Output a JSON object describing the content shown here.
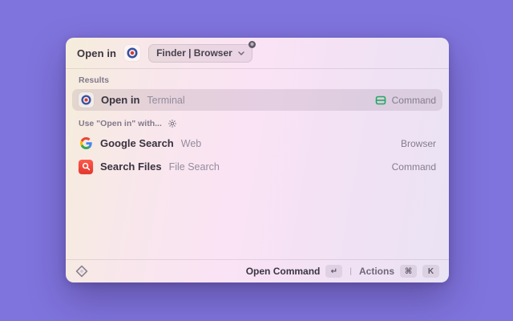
{
  "header": {
    "title": "Open in",
    "pill": {
      "text": "Finder | Browser"
    }
  },
  "sections": {
    "results_label": "Results",
    "use_with_label": "Use \"Open in\" with..."
  },
  "rows": {
    "open_in": {
      "title": "Open in",
      "subtitle": "Terminal",
      "accessory": "Command"
    },
    "google": {
      "title": "Google Search",
      "subtitle": "Web",
      "accessory": "Browser"
    },
    "search_files": {
      "title": "Search Files",
      "subtitle": "File Search",
      "accessory": "Command"
    }
  },
  "footer": {
    "primary_action": "Open Command",
    "primary_key": "↵",
    "divider": "|",
    "secondary_action": "Actions",
    "key_cmd": "⌘",
    "key_k": "K"
  },
  "icons": {
    "extension": "open-in-compass-icon",
    "command_accessory": "terminal-window-icon",
    "settings": "gear-icon",
    "footer_logo": "raycast-diamond-icon"
  },
  "colors": {
    "bg_yellow": "#f5d54d",
    "bg_orange": "#f39e64",
    "bg_pink": "#f062b1",
    "bg_blue": "#6b7ae4",
    "bg_purple": "#504cd6",
    "accessory_green": "#23a863",
    "files_red": "#ee453a",
    "selection": "rgba(95,66,95,0.13)"
  }
}
